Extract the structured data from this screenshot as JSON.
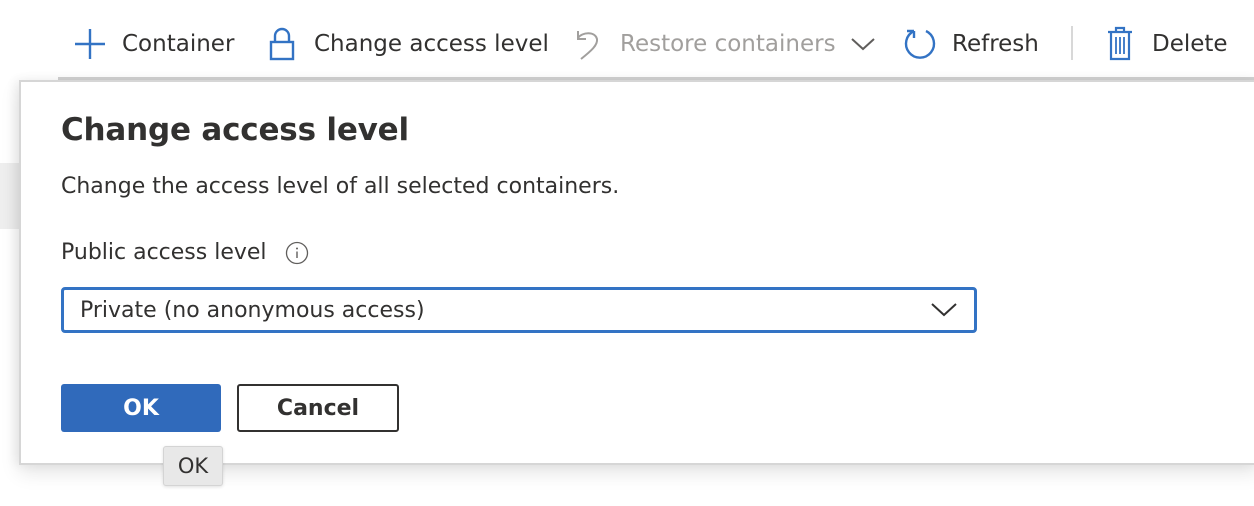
{
  "toolbar": {
    "items": [
      {
        "label": "Container",
        "icon": "plus-icon",
        "enabled": true
      },
      {
        "label": "Change access level",
        "icon": "lock-icon",
        "enabled": true
      },
      {
        "label": "Restore containers",
        "icon": "undo-icon",
        "enabled": false,
        "has_dropdown": true
      },
      {
        "label": "Refresh",
        "icon": "refresh-icon",
        "enabled": true
      },
      {
        "label": "Delete",
        "icon": "trash-icon",
        "enabled": true
      }
    ]
  },
  "dialog": {
    "title": "Change access level",
    "description": "Change the access level of all selected containers.",
    "field_label": "Public access level",
    "field_info_icon": "info-icon",
    "select_value": "Private (no anonymous access)",
    "ok_label": "OK",
    "cancel_label": "Cancel"
  },
  "tooltip": {
    "text": "OK"
  },
  "colors": {
    "accent": "#306abb",
    "icon_blue": "#3373c4",
    "text": "#323130",
    "disabled_text": "#a19f9d"
  }
}
